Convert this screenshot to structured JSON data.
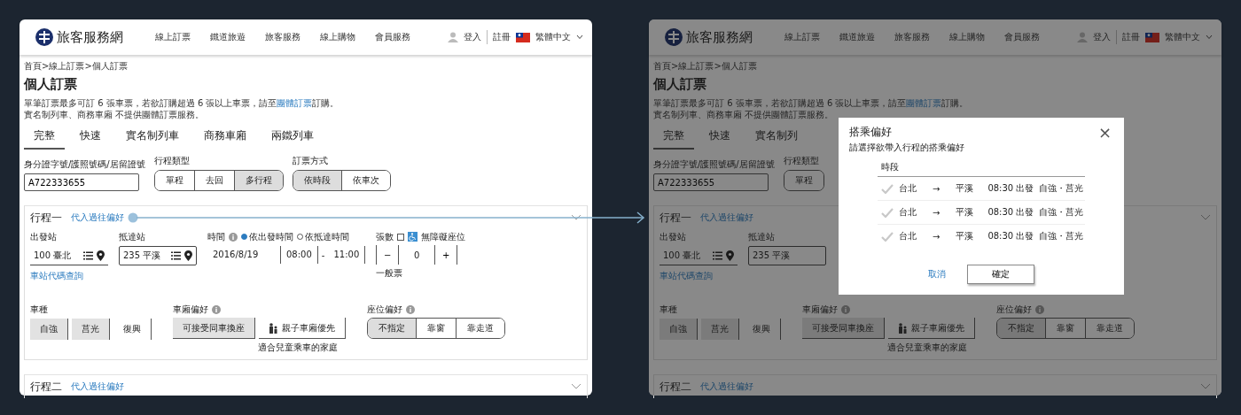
{
  "screens": [
    {
      "dimmed": false,
      "header": {
        "logo": "旅客服務網",
        "nav": [
          "線上訂票",
          "鐵道旅遊",
          "旅客服務",
          "線上購物",
          "會員服務"
        ],
        "login": "登入",
        "register": "註冊",
        "language": "繁體中文"
      },
      "breadcrumb": "首頁>線上訂票>個人訂票",
      "title": "個人訂票",
      "notice": [
        [
          {
            "text": "單筆訂票最多可訂 6 張車票，若欲訂購超過 6 張以上車票，請至"
          },
          {
            "link": "團體訂票"
          },
          {
            "text": "訂購。"
          }
        ],
        [
          {
            "text": "實名制列車、商務車廂 不提供團體訂票服務。"
          }
        ]
      ],
      "tabs": [
        {
          "label": "完整",
          "selected": true
        },
        {
          "label": "快速",
          "selected": false
        },
        {
          "label": "實名制列車",
          "selected": false
        },
        {
          "label": "商務車廂",
          "selected": false
        },
        {
          "label": "兩鐵列車",
          "selected": false
        }
      ],
      "id_field": {
        "label": "身分證字號/護照號碼/居留證號",
        "value": "A722333655"
      },
      "trip_type": {
        "label": "行程類型",
        "options": [
          {
            "label": "單程",
            "selected": false
          },
          {
            "label": "去回",
            "selected": false
          },
          {
            "label": "多行程",
            "selected": true
          }
        ]
      },
      "booking_method": {
        "label": "訂票方式",
        "options": [
          {
            "label": "依時段",
            "selected": true
          },
          {
            "label": "依車次",
            "selected": false
          }
        ]
      },
      "trips": [
        {
          "title": "行程一",
          "link": "代入過往偏好",
          "from": {
            "label": "出發站",
            "value": "100 臺北",
            "kind": "lookup",
            "focused": false
          },
          "to": {
            "label": "抵達站",
            "value": "235 平溪",
            "kind": "lookup",
            "focused": true
          },
          "station_link": "車站代碼查詢",
          "time": {
            "label": "時間",
            "modes": [
              {
                "label": "依出發時間",
                "selected": true
              },
              {
                "label": "依抵達時間",
                "selected": false
              }
            ],
            "date": "2016/8/19",
            "start": "08:00",
            "dash": "-",
            "end": "11:00"
          },
          "tickets": {
            "label": "張數",
            "accessible": {
              "label": "無障礙座位",
              "checked": false
            },
            "minus": "−",
            "count": "0",
            "plus": "+",
            "type": "一般票"
          },
          "train_type": {
            "label": "車種",
            "options": [
              {
                "label": "自強",
                "selected": true
              },
              {
                "label": "莒光",
                "selected": true
              },
              {
                "label": "復興",
                "selected": false
              }
            ]
          },
          "car_pref": {
            "label": "車廂偏好",
            "options": [
              {
                "label": "可接受同車換座",
                "selected": true,
                "kind": "plain"
              },
              {
                "label": "親子車廂優先",
                "selected": false,
                "kind": "family"
              }
            ],
            "note": "適合兒童乘車的家庭"
          },
          "seat_pref": {
            "label": "座位偏好",
            "options": [
              {
                "label": "不指定",
                "selected": true
              },
              {
                "label": "靠窗",
                "selected": false
              },
              {
                "label": "靠走道",
                "selected": false
              }
            ]
          }
        },
        {
          "title": "行程二",
          "link": "代入過往偏好"
        }
      ]
    },
    {
      "dimmed": true,
      "header": {
        "logo": "旅客服務網",
        "nav": [
          "線上訂票",
          "鐵道旅遊",
          "旅客服務",
          "線上購物",
          "會員服務"
        ],
        "login": "登入",
        "register": "註冊",
        "language": "繁體中文"
      },
      "breadcrumb": "首頁>線上訂票>個人訂票",
      "title": "個人訂票",
      "notice": [
        [
          {
            "text": "單筆訂票最多可訂 6 張車票，若欲訂購超過 6 張以上車票，請至"
          },
          {
            "link": "團體訂票"
          },
          {
            "text": "訂購。"
          }
        ],
        [
          {
            "text": "實名制列車、商務車廂 不提供團體訂票服務。"
          }
        ]
      ],
      "tabs": [
        {
          "label": "完整",
          "selected": true
        },
        {
          "label": "快速",
          "selected": false
        },
        {
          "label": "實名制列",
          "selected": false
        }
      ],
      "id_field": {
        "label": "身分證字號/護照號碼/居留證號",
        "value": "A722333655"
      },
      "trip_type": {
        "label": "行程類型",
        "options": [
          {
            "label": "單程",
            "selected": false
          }
        ]
      },
      "trips": [
        {
          "title": "行程一",
          "link": "代入過往偏好",
          "from": {
            "label": "出發站",
            "value": "100 臺北",
            "kind": "lookup",
            "focused": false
          },
          "to": {
            "label": "抵達站",
            "value": "235 平溪",
            "kind": "plain",
            "focused": true
          },
          "station_link": "車站代碼查詢",
          "train_type": {
            "label": "車種",
            "options": [
              {
                "label": "自強",
                "selected": true
              },
              {
                "label": "莒光",
                "selected": true
              },
              {
                "label": "復興",
                "selected": false
              }
            ]
          },
          "car_pref": {
            "label": "車廂偏好",
            "options": [
              {
                "label": "可接受同車換座",
                "selected": true,
                "kind": "plain"
              },
              {
                "label": "親子車廂優先",
                "selected": false,
                "kind": "family"
              }
            ],
            "note": "適合兒童乘車的家庭"
          },
          "seat_pref": {
            "label": "座位偏好",
            "options": [
              {
                "label": "不指定",
                "selected": true
              },
              {
                "label": "靠窗",
                "selected": false
              },
              {
                "label": "靠走道",
                "selected": false
              }
            ]
          }
        },
        {
          "title": "行程二",
          "link": "代入過往偏好"
        }
      ]
    }
  ],
  "modal": {
    "title": "搭乘偏好",
    "close": "×",
    "subtitle": "請選擇欲帶入行程的搭乘偏好",
    "column": "時段",
    "rows": [
      {
        "selected": false,
        "from": "台北",
        "arrow": "→",
        "to": "平溪",
        "time": "08:30 出發",
        "trains": "自強・莒光"
      },
      {
        "selected": false,
        "from": "台北",
        "arrow": "→",
        "to": "平溪",
        "time": "08:30 出發",
        "trains": "自強・莒光"
      },
      {
        "selected": false,
        "from": "台北",
        "arrow": "→",
        "to": "平溪",
        "time": "08:30 出發",
        "trains": "自強・莒光"
      }
    ],
    "cancel": "取消",
    "confirm": "確定"
  }
}
